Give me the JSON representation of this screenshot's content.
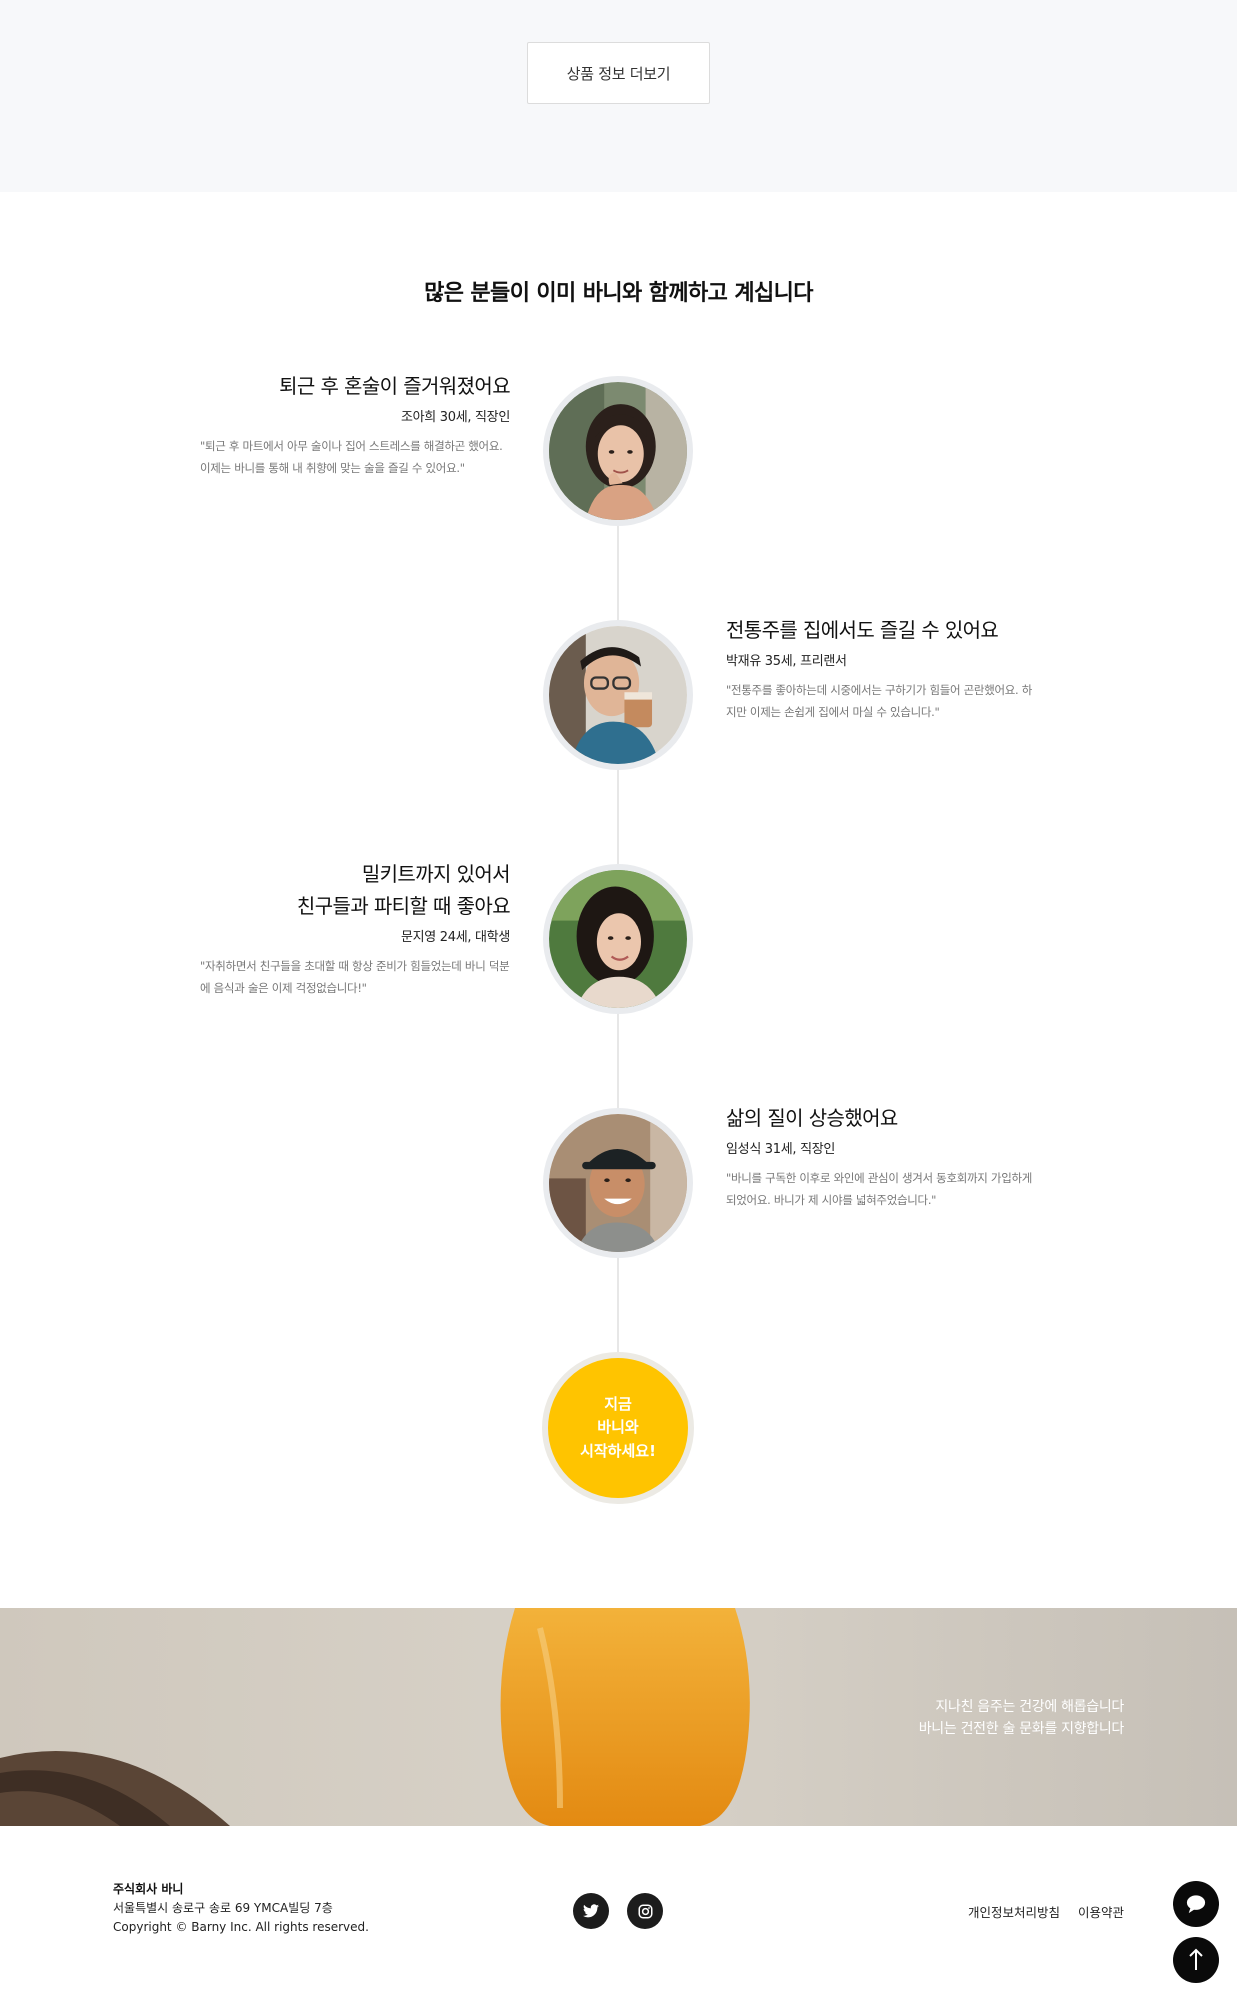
{
  "more_button": {
    "label": "상품 정보 더보기"
  },
  "section": {
    "title": "많은 분들이 이미 바니와 함께하고 계십니다"
  },
  "testimonials": [
    {
      "title": "퇴근 후 혼술이 즐거워졌어요",
      "meta": "조아희 30세, 직장인",
      "quote": "\"퇴근 후 마트에서 아무 술이나 집어 스트레스를 해결하곤 했어요. 이제는 바니를 통해 내 취향에 맞는 술을 즐길 수 있어요.\""
    },
    {
      "title": "전통주를 집에서도 즐길 수 있어요",
      "meta": "박재유 35세, 프리랜서",
      "quote": "\"전통주를 좋아하는데 시중에서는 구하기가 힘들어 곤란했어요. 하지만 이제는 손쉽게 집에서 마실 수 있습니다.\""
    },
    {
      "title_line1": "밀키트까지 있어서",
      "title_line2": "친구들과 파티할 때 좋아요",
      "meta": "문지영 24세, 대학생",
      "quote": "\"자취하면서 친구들을 초대할 때 항상 준비가 힘들었는데 바니 덕분에 음식과 술은 이제 걱정없습니다!\""
    },
    {
      "title": "삶의 질이 상승했어요",
      "meta": "임성식 31세, 직장인",
      "quote": "\"바니를 구독한 이후로 와인에 관심이 생겨서 동호회까지 가입하게 되었어요. 바니가 제 시야를 넓혀주었습니다.\""
    }
  ],
  "cta": {
    "label": "지금\n바니와\n시작하세요!",
    "color": "#ffc400"
  },
  "banner": {
    "line1": "지나친 음주는 건강에 해롭습니다",
    "line2": "바니는 건전한 술 문화를 지향합니다"
  },
  "footer": {
    "company": "주식회사 바니",
    "address": "서울특별시 송로구 송로 69 YMCA빌딩 7층",
    "copyright": "Copyright © Barny Inc. All rights reserved.",
    "social": [
      {
        "icon": "twitter-icon"
      },
      {
        "icon": "instagram-icon"
      }
    ],
    "links": [
      "개인정보처리방침",
      "이용약관"
    ]
  },
  "floating": {
    "chat_icon": "chat-bubble-icon",
    "top_icon": "arrow-up-icon"
  }
}
